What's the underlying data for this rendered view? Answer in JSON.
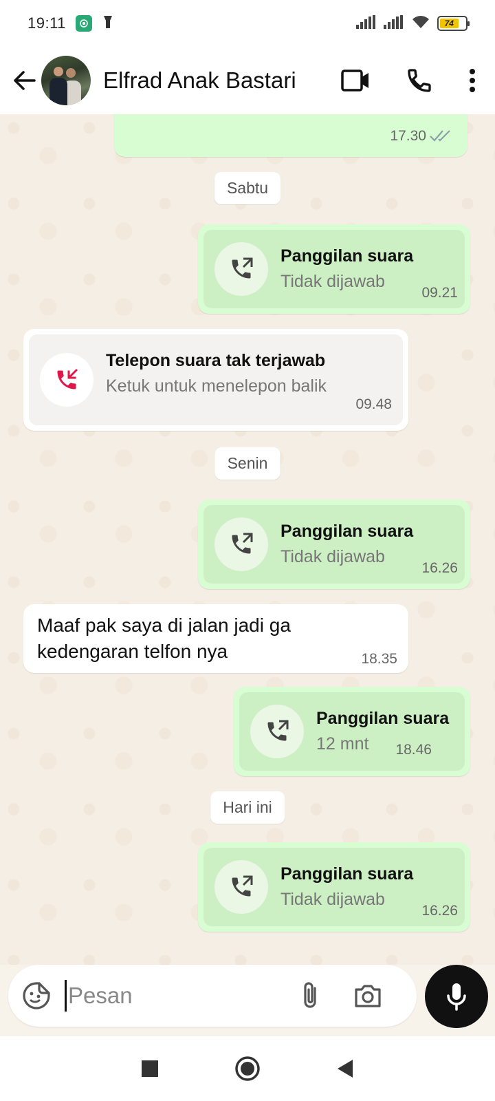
{
  "status_bar": {
    "time": "19:11",
    "battery_level": "74",
    "battery_fraction": 0.74
  },
  "header": {
    "contact_name": "Elfrad Anak Bastari",
    "icons": [
      "back-arrow-icon",
      "video-call-icon",
      "voice-call-icon",
      "more-options-icon"
    ]
  },
  "chat": {
    "top_partial": {
      "time": "17.30"
    },
    "date_saturday": "Sabtu",
    "call1": {
      "title": "Panggilan suara",
      "subtitle": "Tidak dijawab",
      "time": "09.21"
    },
    "missed_call": {
      "title": "Telepon suara tak terjawab",
      "subtitle": "Ketuk untuk menelepon balik",
      "time": "09.48"
    },
    "date_monday": "Senin",
    "call2": {
      "title": "Panggilan suara",
      "subtitle": "Tidak dijawab",
      "time": "16.26"
    },
    "text_msg": {
      "line1": "Maaf pak saya di jalan jadi ga",
      "line2": "kedengaran telfon nya",
      "time": "18.35"
    },
    "call3": {
      "title": "Panggilan suara",
      "subtitle": "12 mnt",
      "time": "18.46"
    },
    "date_today": "Hari ini",
    "call4": {
      "title": "Panggilan suara",
      "subtitle": "Tidak dijawab",
      "time": "16.26"
    }
  },
  "composer": {
    "placeholder": "Pesan"
  },
  "colors": {
    "outgoing_bubble": "#d9fdd3",
    "incoming_bubble": "#ffffff",
    "missed_call_red": "#e0174a",
    "read_tick": "#8aa0a8"
  }
}
